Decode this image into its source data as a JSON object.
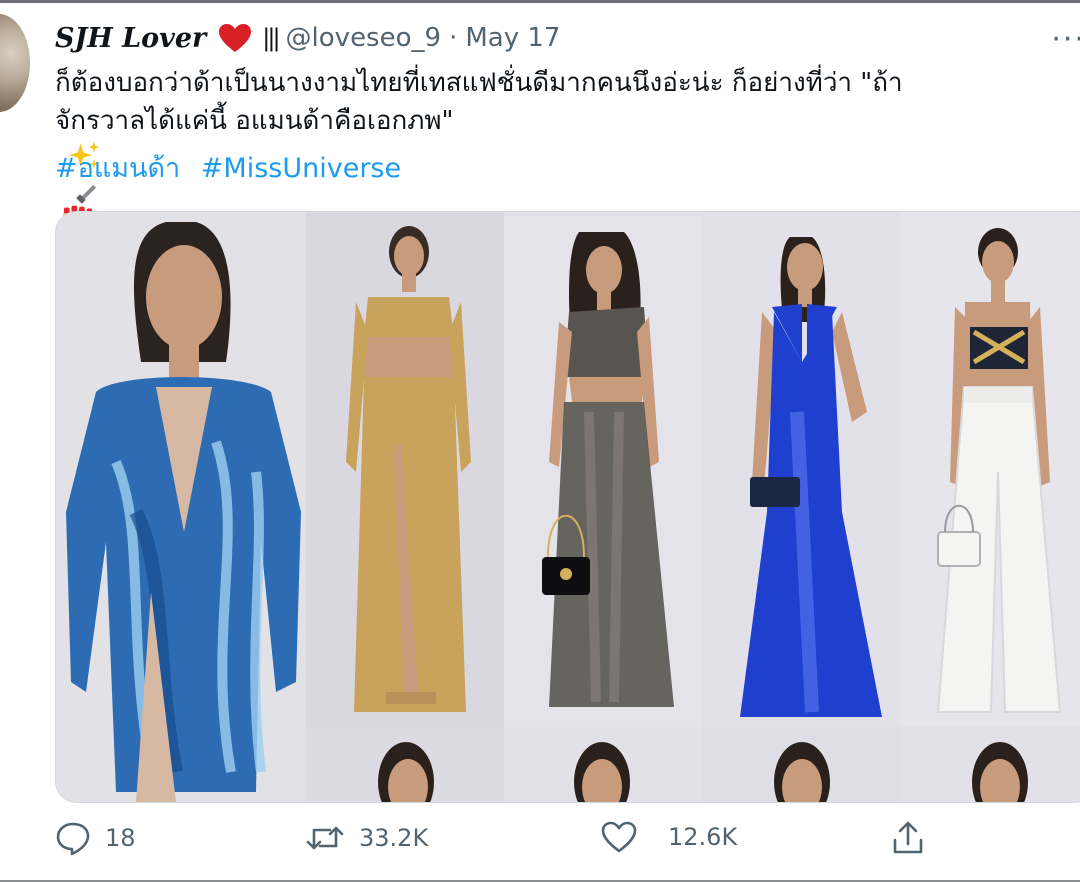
{
  "tweet": {
    "display_name": "SJH Lover",
    "name_emoji": "heart",
    "name_suffix": "|||",
    "handle": "@loveseo_9",
    "separator": "·",
    "date": "May 17",
    "more_label": "···",
    "text_line1": "ก็ต้องบอกว่าด้าเป็นนางงามไทยที่เทสแฟชั่นดีมากคนนึงอ่ะน่ะ ก็อย่างที่ว่า \"ถ้า",
    "text_line2": "จักรวาลได้แค่นี้ อแมนด้าคือเอกภพ\"",
    "emojis": [
      "sparkles-icon",
      "nail-polish-icon"
    ],
    "hashtags": [
      "#อแมนด้า",
      "#MissUniverse"
    ]
  },
  "media": {
    "photos": [
      {
        "name": "blue-sequin-gown",
        "dress_color": "#2d6cb3"
      },
      {
        "name": "gold-two-piece",
        "dress_color": "#c9a25c"
      },
      {
        "name": "grey-sheer-set",
        "dress_color": "#585550"
      },
      {
        "name": "blue-satin-gown",
        "dress_color": "#1f3fcf"
      },
      {
        "name": "white-trousers-set",
        "dress_color": "#f4f4f2"
      }
    ]
  },
  "actions": {
    "replies": "18",
    "retweets": "33.2K",
    "likes": "12.6K"
  },
  "colors": {
    "link": "#1d9bf0",
    "secondary_text": "#536471",
    "heart": "#d92027"
  }
}
